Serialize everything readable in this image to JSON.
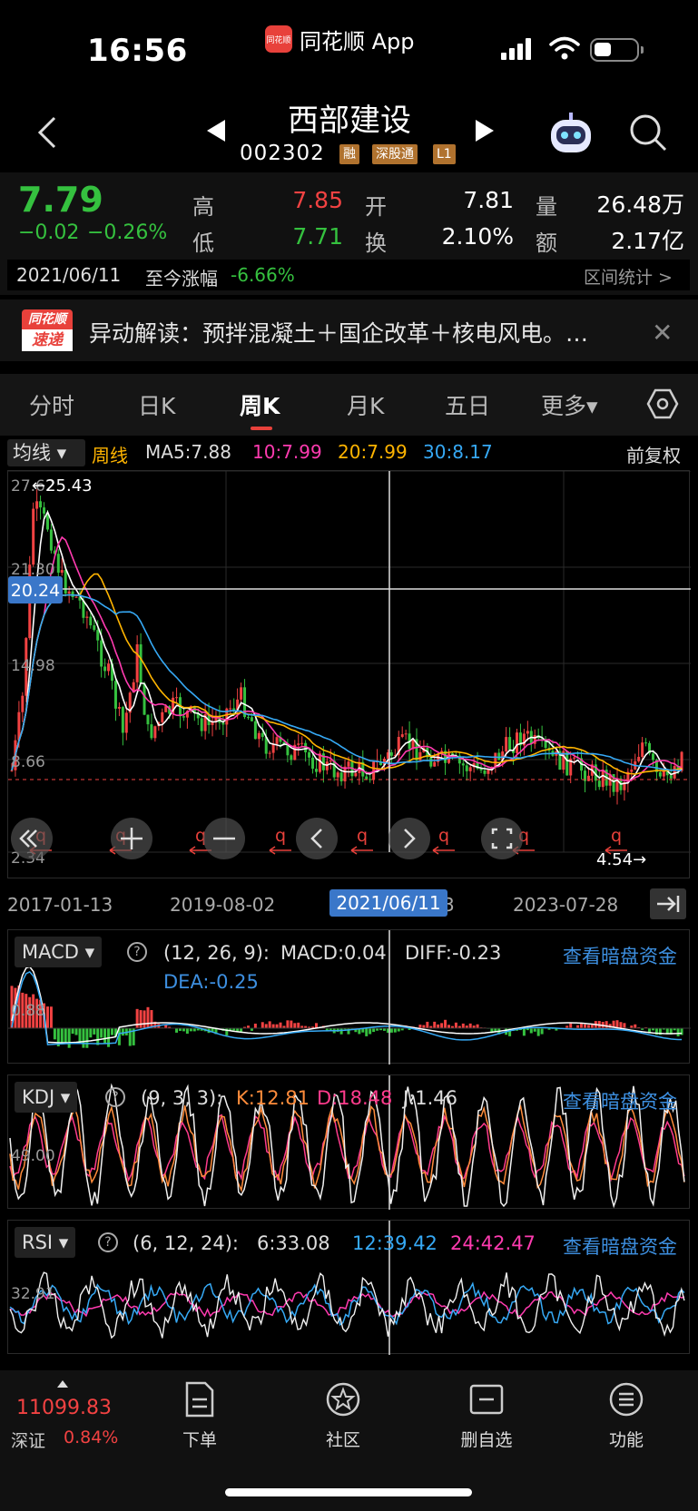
{
  "status": {
    "time": "16:56",
    "app_name": "同花顺 App",
    "app_logo_text": "同花顺"
  },
  "header": {
    "stock_name": "西部建设",
    "stock_code": "002302",
    "tags": [
      "融",
      "深股通",
      "L1"
    ]
  },
  "quote": {
    "price": "7.79",
    "change": "−0.02",
    "change_pct": "−0.26%",
    "high_label": "高",
    "high": "7.85",
    "low_label": "低",
    "low": "7.71",
    "open_label": "开",
    "open": "7.81",
    "turnover_label": "换",
    "turnover": "2.10%",
    "volume_label": "量",
    "volume": "26.48万",
    "amount_label": "额",
    "amount": "2.17亿"
  },
  "range": {
    "date": "2021/06/11",
    "label": "至今涨幅",
    "value": "-6.66%",
    "stat_link": "区间统计 >"
  },
  "news": {
    "logo_top": "同花顺",
    "logo_bottom": "速递",
    "text": "异动解读：预拌混凝土＋国企改革＋核电风电。…",
    "close": "✕"
  },
  "tabs": [
    "分时",
    "日K",
    "周K",
    "月K",
    "五日",
    "更多▾"
  ],
  "ma": {
    "select": "均线 ▾",
    "period": "周线",
    "ma5": "MA5:7.88",
    "ma10": "10:7.99",
    "ma20": "20:7.99",
    "ma30": "30:8.17",
    "adjust": "前复权",
    "colors": {
      "ma5": "#ffffff",
      "ma10": "#ff3bb0",
      "ma20": "#ffb400",
      "ma30": "#36a9f5"
    }
  },
  "kline": {
    "y_labels": [
      "27.62",
      "21.30",
      "14.98",
      "8.66",
      "2.34"
    ],
    "max_label": "←25.43",
    "min_label": "4.54→",
    "cross_price": "20.24",
    "cross_date": "2021/06/11",
    "x_labels": [
      "2017-01-13",
      "2019-08-02",
      "3",
      "2023-07-28"
    ],
    "markers": [
      "q",
      "q",
      "q",
      "q",
      "q",
      "q",
      "q",
      "q"
    ]
  },
  "macd": {
    "select": "MACD ▾",
    "params": "(12, 26, 9):",
    "macd": "MACD:0.04",
    "diff": "DIFF:-0.23",
    "dea": "DEA:-0.25",
    "link": "查看暗盘资金",
    "y_label": "0.88"
  },
  "kdj": {
    "select": "KDJ ▾",
    "params": "(9, 3, 3):",
    "k": "K:12.81",
    "d": "D:18.48",
    "j": "J:1.46",
    "link": "查看暗盘资金",
    "y_label": "49.00"
  },
  "rsi": {
    "select": "RSI ▾",
    "params": "(6, 12, 24):",
    "r6": "6:33.08",
    "r12": "12:39.42",
    "r24": "24:42.47",
    "link": "查看暗盘资金",
    "y_label": "32.91"
  },
  "bottom": {
    "index_value": "11099.83",
    "index_name": "深证",
    "index_change": "0.84%",
    "buttons": [
      "下单",
      "社区",
      "删自选",
      "功能"
    ]
  }
}
